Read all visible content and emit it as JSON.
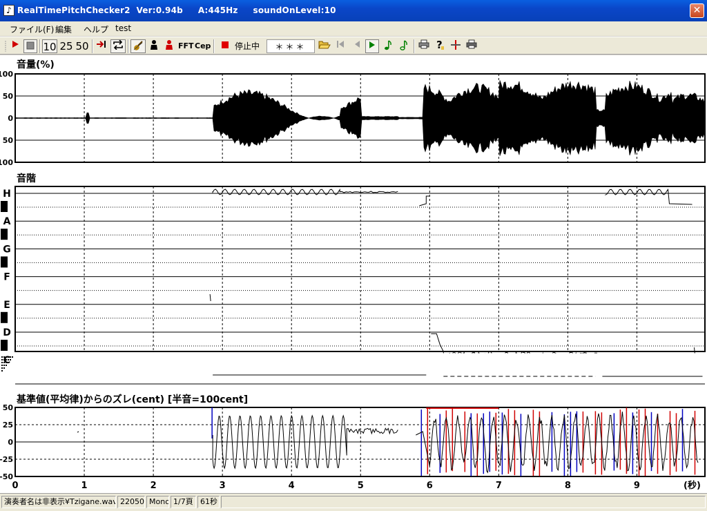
{
  "window": {
    "title": "RealTimePitchChecker2  Ver:0.94b     A:445Hz     soundOnLevel:10",
    "close_label": "✕",
    "app_icon": "♪"
  },
  "menu": {
    "items": [
      "ファイル(F)",
      "編集",
      "ヘルプ",
      "test"
    ]
  },
  "toolbar": {
    "zoom_options": [
      "10",
      "25",
      "50"
    ],
    "fft_label": "FFT",
    "cep_label": "Cep",
    "status_label": "停止中",
    "note_display": "＊＊＊",
    "icons": {
      "play": "play-icon",
      "stop": "stop-icon",
      "skip": "skip-end-icon",
      "loop": "loop-icon",
      "violin": "violin-icon",
      "player_black": "player-icon",
      "player_red": "player-red-icon",
      "record": "record-icon",
      "folder": "folder-open-icon",
      "first": "first-page-icon",
      "prev": "prev-page-icon",
      "next": "next-page-icon",
      "note_green": "note-green-icon",
      "note_green2": "note-alt-icon",
      "print": "print-icon",
      "help": "help-icon",
      "grid": "grid-icon",
      "print2": "print-setup-icon"
    },
    "colors": {
      "record": "#e00000",
      "play": "#d00000",
      "next": "#008000"
    }
  },
  "panels": {
    "volume": {
      "title": "音量(%)",
      "ticks": [
        "100",
        "50",
        "0",
        "50",
        "100"
      ]
    },
    "scale": {
      "title": "音階",
      "notes": [
        "H",
        "A",
        "G",
        "F",
        "E",
        "D",
        "C"
      ]
    },
    "deviation": {
      "title": "基準値(平均律)からのズレ(cent) [半音=100cent]",
      "ticks": [
        "50",
        "25",
        "0",
        "-25",
        "-50"
      ]
    }
  },
  "time_axis": {
    "labels": [
      "0",
      "1",
      "2",
      "3",
      "4",
      "5",
      "6",
      "7",
      "8",
      "9"
    ],
    "unit": "(秒)",
    "range_seconds": [
      0,
      10
    ]
  },
  "statusbar": {
    "file": "演奏者名は非表示¥Tzigane.wav",
    "sample_rate": "22050",
    "channels": "Mono",
    "page": "1/7頁",
    "duration": "61秒"
  }
}
